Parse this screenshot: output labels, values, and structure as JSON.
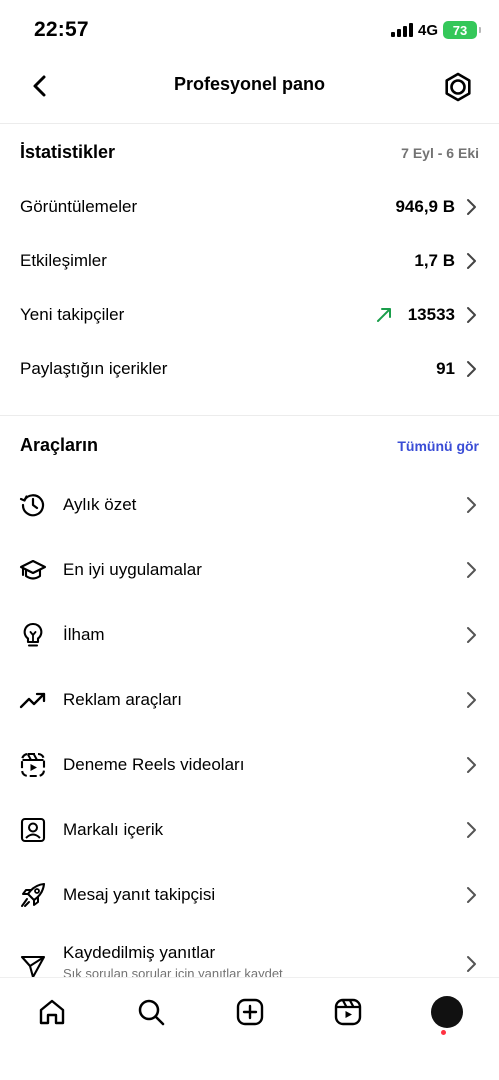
{
  "status_bar": {
    "time": "22:57",
    "network": "4G",
    "battery": "73"
  },
  "header": {
    "title": "Profesyonel pano"
  },
  "stats": {
    "title": "İstatistikler",
    "date_range": "7 Eyl - 6 Eki",
    "rows": [
      {
        "label": "Görüntülemeler",
        "value": "946,9 B"
      },
      {
        "label": "Etkileşimler",
        "value": "1,7 B"
      },
      {
        "label": "Yeni takipçiler",
        "value": "13533",
        "trend": "up"
      },
      {
        "label": "Paylaştığın içerikler",
        "value": "91"
      }
    ]
  },
  "tools": {
    "title": "Araçların",
    "see_all": "Tümünü gör",
    "items": [
      {
        "label": "Aylık özet",
        "icon": "history-icon"
      },
      {
        "label": "En iyi uygulamalar",
        "icon": "graduation-cap-icon"
      },
      {
        "label": "İlham",
        "icon": "lightbulb-icon"
      },
      {
        "label": "Reklam araçları",
        "icon": "trending-up-icon"
      },
      {
        "label": "Deneme Reels videoları",
        "icon": "reels-draft-icon"
      },
      {
        "label": "Markalı içerik",
        "icon": "branded-content-icon"
      },
      {
        "label": "Mesaj yanıt takipçisi",
        "icon": "rocket-icon"
      },
      {
        "label": "Kaydedilmiş yanıtlar",
        "sub": "Sık sorulan sorular için yanıtlar kaydet",
        "icon": "send-icon"
      }
    ]
  },
  "colors": {
    "accent": "#3a4dd6",
    "trend": "#1a9e4b",
    "battery": "#34c759",
    "notification": "#ff3040"
  }
}
